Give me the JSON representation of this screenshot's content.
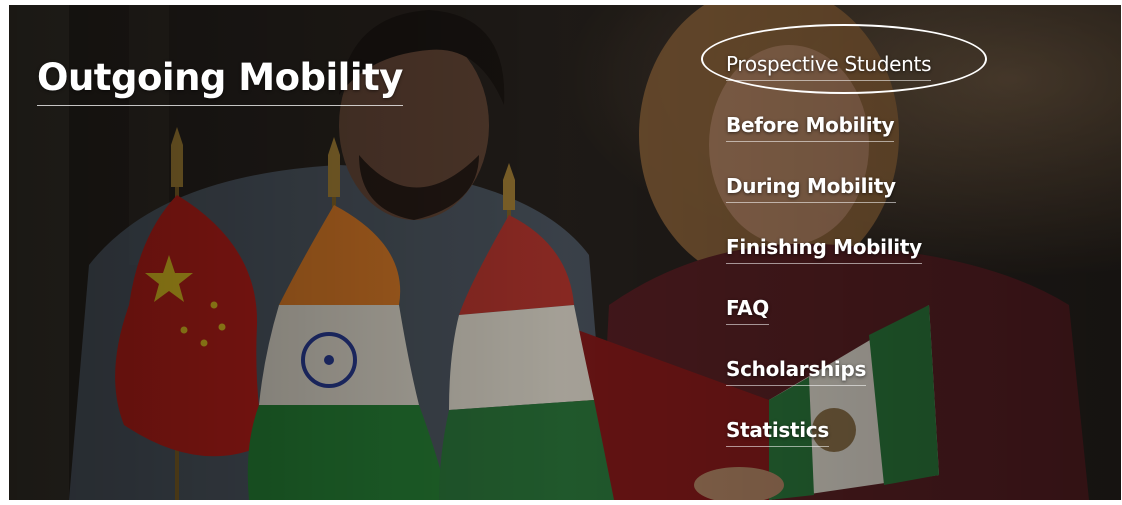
{
  "page": {
    "title": "Outgoing Mobility"
  },
  "nav": {
    "items": [
      {
        "label": "Prospective Students",
        "active": true
      },
      {
        "label": "Before Mobility"
      },
      {
        "label": "During Mobility"
      },
      {
        "label": "Finishing Mobility"
      },
      {
        "label": "FAQ"
      },
      {
        "label": "Scholarships"
      },
      {
        "label": "Statistics"
      }
    ]
  },
  "hero_image": {
    "depicts": [
      "china-flag",
      "india-flag",
      "hungary-flag",
      "mexico-flag-book",
      "two-students"
    ]
  },
  "colors": {
    "text": "#ffffff",
    "china_red": "#c8221c",
    "india_saffron": "#e8832a",
    "india_green": "#2a8a3a",
    "hungary_red": "#c23a32",
    "hungary_green": "#2f7f3f",
    "book_red": "#8e1c1c"
  }
}
